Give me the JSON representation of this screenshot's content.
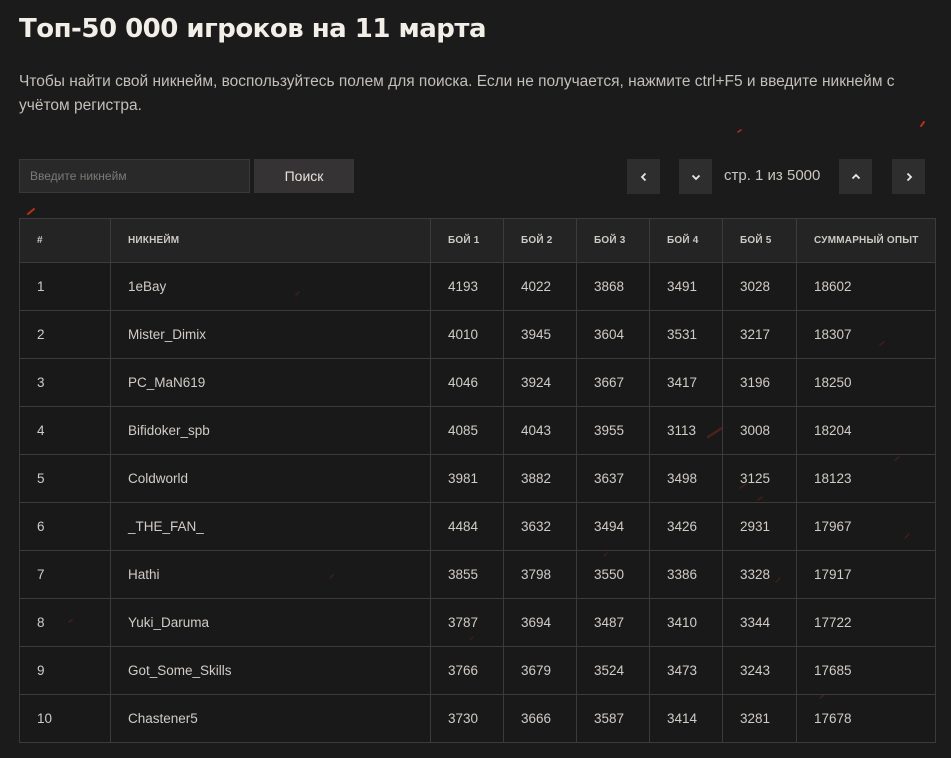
{
  "page": {
    "title": "Топ-50 000 игроков на 11 марта",
    "description": "Чтобы найти свой никнейм, воспользуйтесь полем для поиска. Если не получается, нажмите ctrl+F5 и введите никнейм с учётом регистра."
  },
  "search": {
    "placeholder": "Введите никнейм",
    "value": "",
    "button_label": "Поиск"
  },
  "pagination": {
    "label": "стр. 1 из 5000",
    "prev_icon": "chevron-left-icon",
    "down_icon": "chevron-down-icon",
    "up_icon": "chevron-up-icon",
    "next_icon": "chevron-right-icon"
  },
  "table": {
    "headers": [
      "#",
      "НИКНЕЙМ",
      "БОЙ 1",
      "БОЙ 2",
      "БОЙ 3",
      "БОЙ 4",
      "БОЙ 5",
      "СУММАРНЫЙ ОПЫТ"
    ],
    "rows": [
      [
        "1",
        "1eBay",
        "4193",
        "4022",
        "3868",
        "3491",
        "3028",
        "18602"
      ],
      [
        "2",
        "Mister_Dimix",
        "4010",
        "3945",
        "3604",
        "3531",
        "3217",
        "18307"
      ],
      [
        "3",
        "PC_MaN619",
        "4046",
        "3924",
        "3667",
        "3417",
        "3196",
        "18250"
      ],
      [
        "4",
        "Bifidoker_spb",
        "4085",
        "4043",
        "3955",
        "3113",
        "3008",
        "18204"
      ],
      [
        "5",
        "Coldworld",
        "3981",
        "3882",
        "3637",
        "3498",
        "3125",
        "18123"
      ],
      [
        "6",
        "_THE_FAN_",
        "4484",
        "3632",
        "3494",
        "3426",
        "2931",
        "17967"
      ],
      [
        "7",
        "Hathi",
        "3855",
        "3798",
        "3550",
        "3386",
        "3328",
        "17917"
      ],
      [
        "8",
        "Yuki_Daruma",
        "3787",
        "3694",
        "3487",
        "3410",
        "3344",
        "17722"
      ],
      [
        "9",
        "Got_Some_Skills",
        "3766",
        "3679",
        "3524",
        "3473",
        "3243",
        "17685"
      ],
      [
        "10",
        "Chastener5",
        "3730",
        "3666",
        "3587",
        "3414",
        "3281",
        "17678"
      ]
    ]
  },
  "colors": {
    "background": "#1c1b1b",
    "spark": "#c8341c",
    "text": "#d0ccc6"
  }
}
